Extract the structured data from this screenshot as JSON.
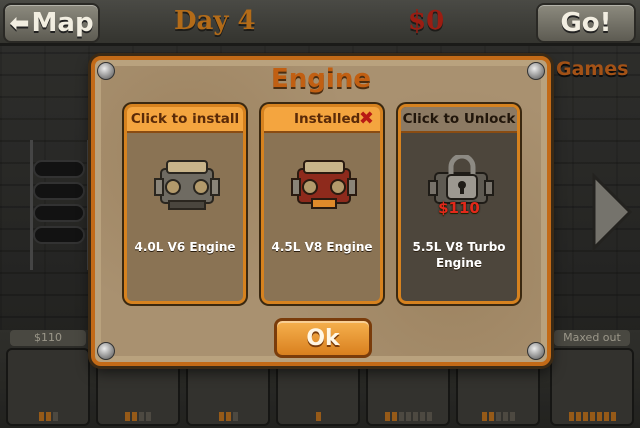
{
  "topbar": {
    "map_label": "Map",
    "day_label": "Day 4",
    "money_label": "$0",
    "go_label": "Go!",
    "games_label": "Games"
  },
  "modal": {
    "title": "Engine",
    "ok_label": "Ok",
    "cards": [
      {
        "header": "Click to install",
        "name": "4.0L V6 Engine",
        "state": "available"
      },
      {
        "header": "Installed",
        "name": "4.5L V8 Engine",
        "state": "installed"
      },
      {
        "header": "Click to Unlock",
        "name": "5.5L V8 Turbo Engine",
        "state": "locked",
        "price": "$110"
      }
    ]
  },
  "bottom_slots": [
    {
      "part": "engine",
      "price_tag": "$110",
      "level": 2,
      "max_level": 3
    },
    {
      "part": "exhaust",
      "level": 2,
      "max_level": 4
    },
    {
      "part": "wheels",
      "level": 2,
      "max_level": 3
    },
    {
      "part": "suspension",
      "level": 1,
      "max_level": 1
    },
    {
      "part": "seats",
      "level": 2,
      "max_level": 7
    },
    {
      "part": "gun",
      "level": 2,
      "max_level": 5
    },
    {
      "part": "fuel-tank",
      "price_tag": "Maxed out",
      "level": 7,
      "max_level": 7
    }
  ],
  "colors": {
    "accent": "#c36a17",
    "card_header": "#f4a53f",
    "lock_price": "#e3281a",
    "money": "#9b1d12",
    "day": "#b36b18"
  }
}
